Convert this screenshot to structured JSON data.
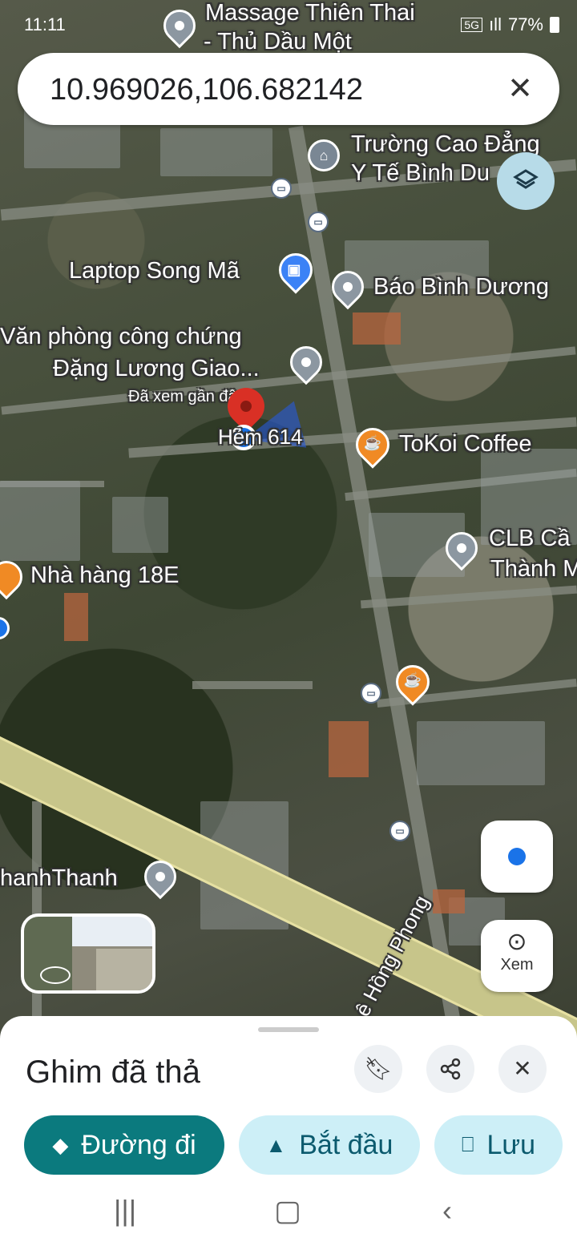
{
  "status_bar": {
    "time": "11:11",
    "network": "5G",
    "signal": "ıll",
    "battery": "77%"
  },
  "search": {
    "value": "10.969026,106.682142",
    "clear_icon": "close-icon"
  },
  "map": {
    "labels": {
      "massage_line1": "Massage Thiên Thai",
      "massage_line2": "- Thủ Dầu Một",
      "college_line1": "Trường Cao Đẳng",
      "college_line2": "Y Tế Bình Du",
      "laptop": "Laptop Song Mã",
      "bao": "Báo Bình Dương",
      "notary_line1": "Văn phòng công chứng",
      "notary_line2": "Đặng Lương Giao...",
      "viewed": "Đã xem gần đây",
      "hem": "Hẻm 614",
      "tokoi": "ToKoi Coffee",
      "clb_line1": "CLB Cầ",
      "clb_line2": "Thành M",
      "restaurant": "Nhà hàng 18E",
      "thanh": "hanhThanh",
      "street": "Lê Hồng Phong"
    }
  },
  "controls": {
    "layers_icon": "layers-icon",
    "location_icon": "my-location-icon",
    "xem_label": "Xem"
  },
  "sheet": {
    "title": "Ghim đã thả",
    "directions_label": "Đường đi",
    "start_label": "Bắt đầu",
    "save_label": "Lưu"
  },
  "colors": {
    "primary": "#0b7a7e",
    "secondary": "#cdeff7",
    "pin_red": "#d93025",
    "location_blue": "#1a73e8"
  }
}
